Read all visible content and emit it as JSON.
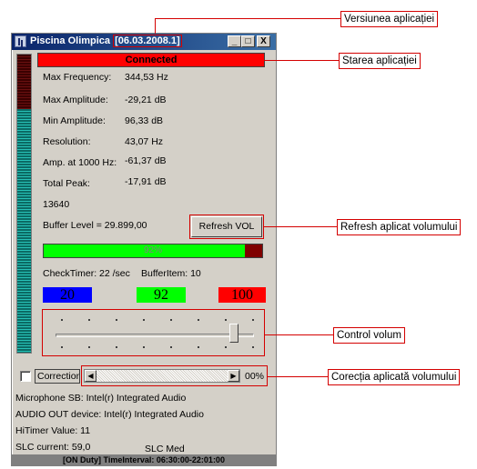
{
  "window": {
    "title": "Piscina Olimpica",
    "version": "[06.03.2008.1]",
    "min_label": "_",
    "max_label": "□",
    "close_label": "X"
  },
  "status_banner": "Connected",
  "metrics": [
    {
      "label": "Max Frequency:",
      "value": "344,53 Hz"
    },
    {
      "label": "Max Amplitude:",
      "value": "-29,21 dB"
    },
    {
      "label": "Min Amplitude:",
      "value": "96,33 dB"
    },
    {
      "label": "Resolution:",
      "value": "43,07 Hz"
    },
    {
      "label": "Amp. at 1000 Hz:",
      "value": "-61,37 dB"
    },
    {
      "label": "Total Peak:",
      "value": "-17,91 dB"
    }
  ],
  "counter": "13640",
  "buffer_level": "Buffer Level = 29.899,00",
  "refresh_button": "Refresh VOL",
  "buffer_bar": {
    "percent_label": "92%",
    "fraction": 0.92
  },
  "check_timer": "CheckTimer: 22 /sec",
  "buffer_item": "BufferItem: 10",
  "indicators": {
    "blue": "20",
    "green": "92",
    "red": "100"
  },
  "volume_slider": {
    "fraction": 0.92
  },
  "correction": {
    "label": "Correction",
    "percent": "00%"
  },
  "info": {
    "microphone": "Microphone SB: Intel(r) Integrated Audio",
    "audio_out": "AUDIO OUT device: Intel(r) Integrated Audio",
    "hitimer": "HiTimer Value: 11",
    "slc_current": "SLC current: 59,0",
    "slc_med": "SLC Med"
  },
  "status_bar": "[ON Duty] TimeInterval: 06:30:00-22:01:00",
  "callouts": {
    "version": "Versiunea aplicației",
    "state": "Starea aplicației",
    "refresh": "Refresh aplicat volumului",
    "volume": "Control volum",
    "correction": "Corecția aplicată volumului"
  }
}
